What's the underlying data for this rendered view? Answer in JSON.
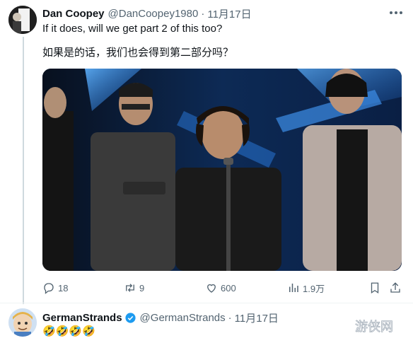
{
  "tweet": {
    "author_name": "Dan Coopey",
    "author_handle": "@DanCoopey1980",
    "separator": "·",
    "date": "11月17日",
    "text_en": "If it does, will we get part 2 of this too?",
    "text_zh": "如果是的话，我们也会得到第二部分吗？",
    "media_icon": "photo-of-stage",
    "actions": {
      "replies": "18",
      "retweets": "9",
      "likes": "600",
      "views": "1.9万"
    },
    "icons": [
      "reply-icon",
      "retweet-icon",
      "like-icon",
      "views-icon",
      "bookmark-icon",
      "share-icon",
      "more-icon"
    ]
  },
  "reply": {
    "author_name": "GermanStrands",
    "author_handle": "@GermanStrands",
    "separator": "·",
    "date": "11月17日",
    "text": "🤣🤣🤣🤣",
    "icons": [
      "verified-icon"
    ]
  },
  "watermark": {
    "text": "游侠网",
    "icon": "watermark-logo"
  },
  "colors": {
    "text": "#0f1419",
    "secondary": "#536471",
    "verified": "#1d9bf0",
    "divider": "#eff3f4",
    "stage_blue": "#1e6fd9"
  }
}
